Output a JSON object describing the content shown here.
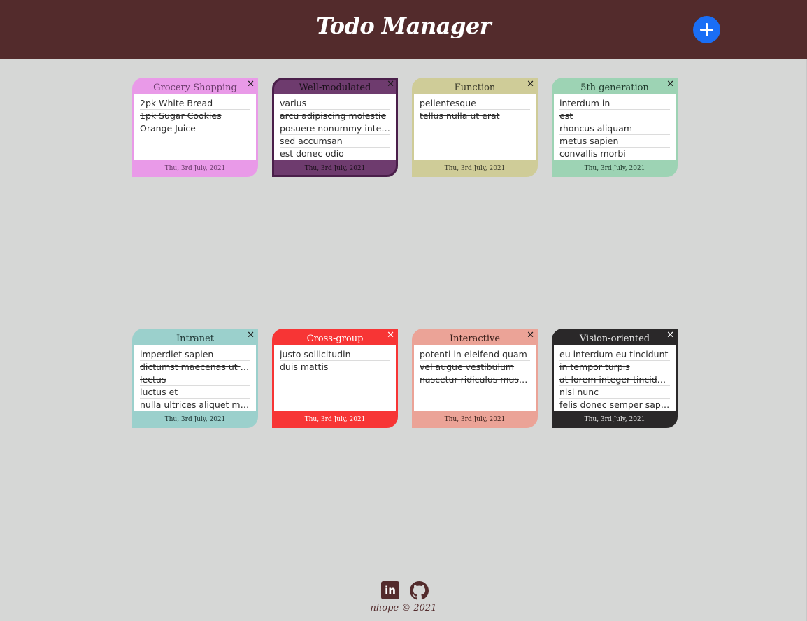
{
  "header": {
    "title": "Todo Manager",
    "add_icon": "plus-icon",
    "background": "#532b2c",
    "add_color": "#1a6ef5"
  },
  "cards": [
    {
      "title": "Grocery Shopping",
      "date": "Thu, 3rd July, 2021",
      "color": "#e99ae8",
      "border": "#e99ae8",
      "title_color": "#6b3b6b",
      "items": [
        {
          "text": "2pk White Bread",
          "done": false
        },
        {
          "text": "1pk Sugar Cookies",
          "done": true
        },
        {
          "text": "Orange Juice",
          "done": false
        }
      ]
    },
    {
      "title": "Well-modulated",
      "date": "Thu, 3rd July, 2021",
      "color": "#6e3b6e",
      "border": "#4a1f4a",
      "title_color": "#1a0f1a",
      "items": [
        {
          "text": "varius",
          "done": true
        },
        {
          "text": "arcu adipiscing molestie",
          "done": true
        },
        {
          "text": "posuere nonummy integer",
          "done": false
        },
        {
          "text": "sed accumsan",
          "done": true
        },
        {
          "text": "est donec odio",
          "done": false
        }
      ]
    },
    {
      "title": "Function",
      "date": "Thu, 3rd July, 2021",
      "color": "#cfcc98",
      "border": "#cfcc98",
      "title_color": "#3a3a2a",
      "items": [
        {
          "text": "pellentesque",
          "done": false
        },
        {
          "text": "tellus nulla ut erat",
          "done": true
        }
      ]
    },
    {
      "title": "5th generation",
      "date": "Thu, 3rd July, 2021",
      "color": "#9dd3b4",
      "border": "#9dd3b4",
      "title_color": "#1f3a2c",
      "items": [
        {
          "text": "interdum in",
          "done": true
        },
        {
          "text": "est",
          "done": true
        },
        {
          "text": "rhoncus aliquam",
          "done": false
        },
        {
          "text": "metus sapien",
          "done": false
        },
        {
          "text": "convallis morbi",
          "done": false
        }
      ]
    },
    {
      "title": "Intranet",
      "date": "Thu, 3rd July, 2021",
      "color": "#9bd0cc",
      "border": "#9bd0cc",
      "title_color": "#1f3635",
      "items": [
        {
          "text": "imperdiet sapien",
          "done": false
        },
        {
          "text": "dictumst maecenas ut massa",
          "done": true
        },
        {
          "text": "lectus",
          "done": true
        },
        {
          "text": "luctus et",
          "done": false
        },
        {
          "text": "nulla ultrices aliquet maecenas",
          "done": false
        }
      ]
    },
    {
      "title": "Cross-group",
      "date": "Thu, 3rd July, 2021",
      "color": "#f73535",
      "border": "#f73535",
      "title_color": "#ffffff",
      "items": [
        {
          "text": "justo sollicitudin",
          "done": false
        },
        {
          "text": "duis mattis",
          "done": false
        }
      ]
    },
    {
      "title": "Interactive",
      "date": "Thu, 3rd July, 2021",
      "color": "#eba397",
      "border": "#eba397",
      "title_color": "#3a1f1a",
      "items": [
        {
          "text": "potenti in eleifend quam",
          "done": false
        },
        {
          "text": "vel augue vestibulum",
          "done": true
        },
        {
          "text": "nascetur ridiculus mus etiam",
          "done": true
        }
      ]
    },
    {
      "title": "Vision-oriented",
      "date": "Thu, 3rd July, 2021",
      "color": "#2a2829",
      "border": "#2a2829",
      "title_color": "#e6e6e6",
      "items": [
        {
          "text": "eu interdum eu tincidunt",
          "done": false
        },
        {
          "text": "in tempor turpis",
          "done": true
        },
        {
          "text": "at lorem integer tincidunt",
          "done": true
        },
        {
          "text": "nisl nunc",
          "done": false
        },
        {
          "text": "felis donec semper sapien",
          "done": false
        }
      ]
    }
  ],
  "footer": {
    "text": "nhope © 2021",
    "linkedin_icon": "linkedin-icon",
    "linkedin_label": "in",
    "github_icon": "github-icon"
  }
}
